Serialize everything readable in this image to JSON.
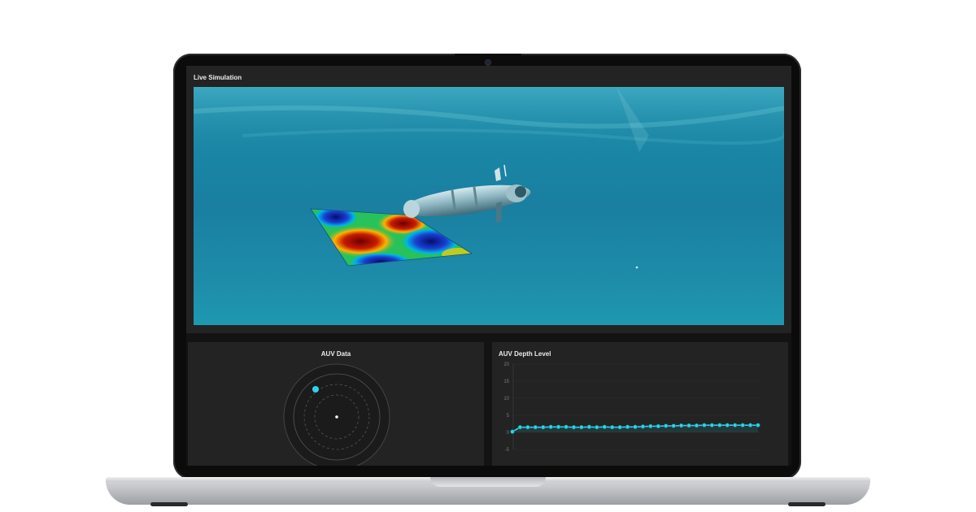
{
  "simulation": {
    "title": "Live Simulation"
  },
  "auv_data": {
    "title": "AUV Data"
  },
  "depth_panel": {
    "title": "AUV Depth Level"
  },
  "colors": {
    "accent": "#2bd5e8",
    "panel": "#232324",
    "water": "#1a86a5"
  },
  "chart_data": {
    "type": "line",
    "title": "AUV Depth Level",
    "ylim": [
      -5,
      20
    ],
    "y_ticks": [
      "20",
      "15",
      "10",
      "5",
      "0",
      "-5"
    ],
    "series": [
      {
        "values": [
          0.2,
          1.5,
          1.5,
          1.5,
          1.5,
          1.6,
          1.6,
          1.6,
          1.5,
          1.5,
          1.6,
          1.5,
          1.6,
          1.5,
          1.5,
          1.6,
          1.6,
          1.7,
          1.8,
          1.8,
          1.9,
          1.9,
          2.0,
          2.0,
          2.0,
          2.1,
          2.1,
          2.1,
          2.1,
          2.1,
          2.1,
          2.1,
          2.1
        ]
      }
    ],
    "grid": true
  }
}
